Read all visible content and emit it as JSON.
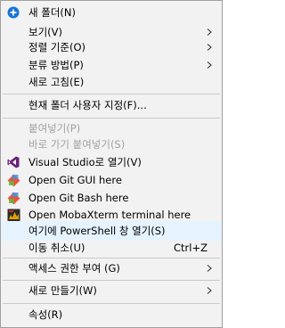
{
  "menu": {
    "items": [
      {
        "label": "새 폴더(N)",
        "icon": "new-folder-icon"
      },
      {
        "label": "보기(V)",
        "submenu": true
      },
      {
        "label": "정렬 기준(O)",
        "submenu": true
      },
      {
        "label": "분류 방법(P)",
        "submenu": true
      },
      {
        "label": "새로 고침(E)"
      },
      {
        "label": "현재 폴더 사용자 지정(F)..."
      },
      {
        "label": "붙여넣기(P)",
        "disabled": true
      },
      {
        "label": "바로 가기 붙여넣기(S)",
        "disabled": true
      },
      {
        "label": "Visual Studio로 열기(V)",
        "icon": "visual-studio-icon"
      },
      {
        "label": "Open Git GUI here",
        "icon": "git-gui-icon"
      },
      {
        "label": "Open Git Bash here",
        "icon": "git-bash-icon"
      },
      {
        "label": "Open MobaXterm terminal here",
        "icon": "mobaxterm-icon"
      },
      {
        "label": "여기에 PowerShell 창 열기(S)",
        "highlighted": true
      },
      {
        "label": "이동 취소(U)",
        "shortcut": "Ctrl+Z"
      },
      {
        "label": "액세스 권한 부여 (G)",
        "submenu": true
      },
      {
        "label": "새로 만들기(W)",
        "submenu": true
      },
      {
        "label": "속성(R)"
      }
    ]
  },
  "colors": {
    "background": "#f2f2f2",
    "border": "#a0a0a0",
    "highlight": "#e5f3ff",
    "disabled_text": "#a0a0a0",
    "new_folder_blue": "#1a73d9",
    "visual_studio_purple": "#68217a",
    "git_orange": "#f05133"
  }
}
